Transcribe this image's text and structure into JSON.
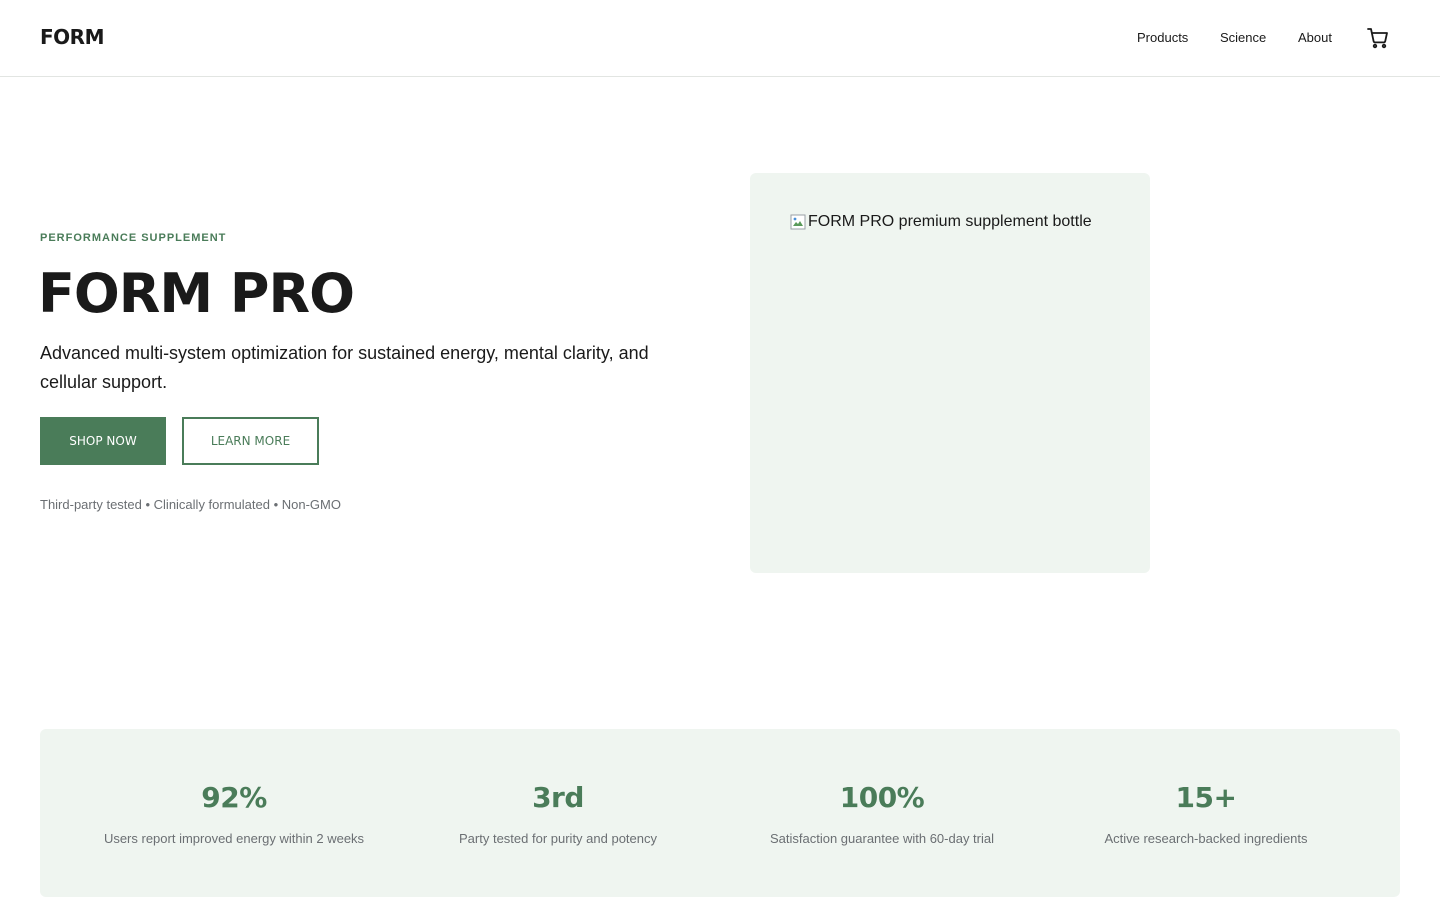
{
  "header": {
    "logo": "FORM",
    "nav": [
      "Products",
      "Science",
      "About"
    ],
    "cart_icon": "cart-icon"
  },
  "hero": {
    "eyebrow": "PERFORMANCE SUPPLEMENT",
    "title": "FORM PRO",
    "subtitle": "Advanced multi-system optimization for sustained energy, mental clarity, and cellular support.",
    "primary_cta": "SHOP NOW",
    "secondary_cta": "LEARN MORE",
    "trust_line": "Third-party tested • Clinically formulated • Non-GMO"
  },
  "product": {
    "image_alt": "FORM PRO premium supplement bottle",
    "image_icon": "broken-image-icon"
  },
  "stats": [
    {
      "value": "92%",
      "label": "Users report improved energy within 2 weeks"
    },
    {
      "value": "3rd",
      "label": "Party tested for purity and potency"
    },
    {
      "value": "100%",
      "label": "Satisfaction guarantee with 60-day trial"
    },
    {
      "value": "15+",
      "label": "Active research-backed ingredients"
    }
  ],
  "colors": {
    "accent": "#4a7c59",
    "panel_bg": "#eff5f0",
    "muted_text": "#6b6f73"
  }
}
